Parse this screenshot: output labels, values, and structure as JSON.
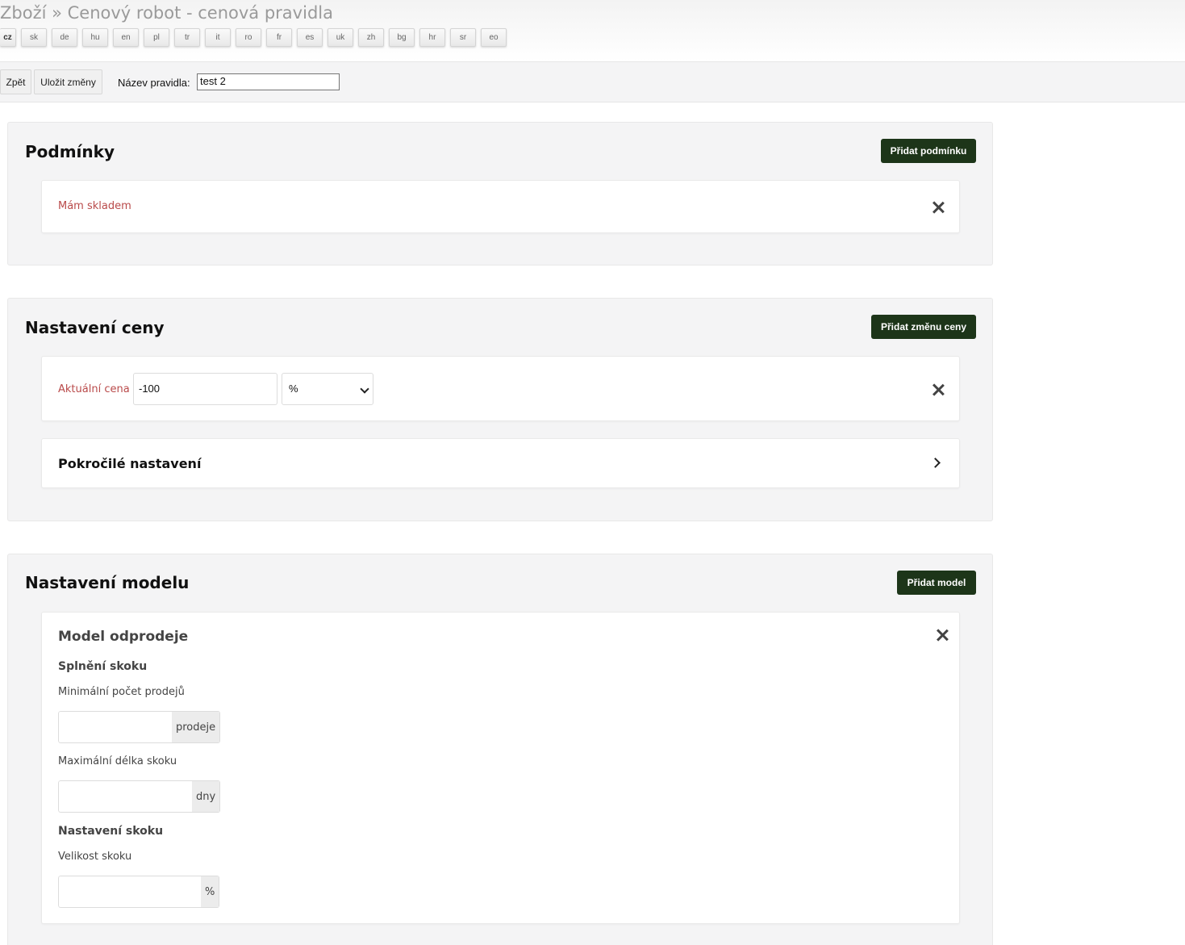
{
  "header": {
    "title": "Zboží » Cenový robot - cenová pravidla",
    "languages": [
      "cz",
      "sk",
      "de",
      "hu",
      "en",
      "pl",
      "tr",
      "it",
      "ro",
      "fr",
      "es",
      "uk",
      "zh",
      "bg",
      "hr",
      "sr",
      "eo"
    ],
    "active_language": "cz"
  },
  "toolbar": {
    "back_label": "Zpět",
    "save_label": "Uložit změny",
    "rule_name_label": "Název pravidla:",
    "rule_name_value": "test 2"
  },
  "conditions": {
    "title": "Podmínky",
    "add_label": "Přidat podmínku",
    "items": [
      {
        "label": "Mám skladem"
      }
    ]
  },
  "price_settings": {
    "title": "Nastavení ceny",
    "add_label": "Přidat změnu ceny",
    "current_price_label": "Aktuální cena",
    "current_price_value": "-100",
    "unit_value": "%",
    "advanced_label": "Pokročilé nastavení"
  },
  "model_settings": {
    "title": "Nastavení modelu",
    "add_label": "Přidat model",
    "model": {
      "title": "Model odprodeje",
      "jump_fulfillment_head": "Splnění skoku",
      "min_sales_label": "Minimální počet prodejů",
      "min_sales_unit": "prodeje",
      "max_jump_label": "Maximální délka skoku",
      "max_jump_unit": "dny",
      "jump_settings_head": "Nastavení skoku",
      "jump_size_label": "Velikost skoku",
      "jump_size_unit": "%"
    }
  },
  "colors": {
    "accent_button": "#1d3519",
    "condition_text": "#b94a4a",
    "panel_bg": "#f4f4f5"
  }
}
